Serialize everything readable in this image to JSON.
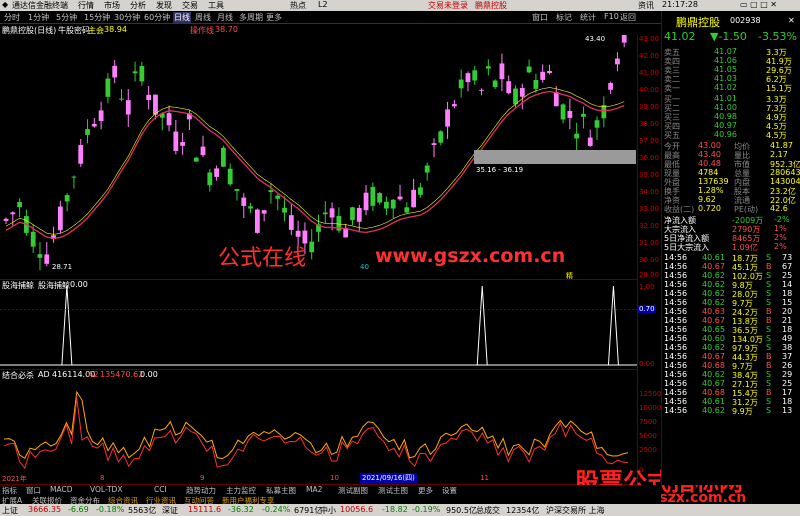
{
  "topbar": {
    "app": "通达信金融终端",
    "menus": [
      "行情",
      "市场",
      "分析",
      "发现",
      "交易",
      "工具",
      "热点",
      "L2"
    ],
    "notice": "交易未登录",
    "stock_tag": "鹏鼎控股",
    "right_items": [
      "资讯",
      "画图",
      "消息",
      "工具"
    ],
    "clock": "21:17:28"
  },
  "periods": [
    "分时",
    "1分钟",
    "5分钟",
    "15分钟",
    "30分钟",
    "60分钟",
    "日线",
    "周线",
    "月线",
    "多周期",
    "更多"
  ],
  "tools": [
    "窗口",
    "标记",
    "统计",
    "F10",
    "返回"
  ],
  "info": {
    "name": "鹏鼎控股(日线)",
    "ind": "牛股密码",
    "lbl1": "主会",
    "v1": "38.94",
    "lbl2": "操作线",
    "v2": "38.70"
  },
  "chart": {
    "high_label": "43.40",
    "low_label": "28.71",
    "range_label": "35.16 - 36.19",
    "date_mark": "2021/09/16(四)",
    "year_left": "2021年",
    "month_left": "8",
    "mid": "9",
    "right": "10",
    "month_right": "11",
    "marker1": "40",
    "marker2": "精",
    "marker3": "精"
  },
  "axis_main": [
    "43.00",
    "42.00",
    "41.00",
    "40.00",
    "39.00",
    "38.00",
    "37.00",
    "36.00",
    "35.00",
    "34.00",
    "33.00",
    "32.00",
    "31.00",
    "30.00",
    "29.00"
  ],
  "p2": {
    "title": "股海捕鲸",
    "sub": "股海捕鲸",
    "val": "0.00",
    "axis": [
      "1.00",
      "0.70",
      "0.00"
    ],
    "ylim": [
      0,
      1
    ],
    "spike_x": [
      0.105,
      0.757,
      0.963
    ]
  },
  "p3": {
    "title": "结合必杀",
    "ad": "AD",
    "adv": "416114.00",
    "a2": "A2",
    "a2v": "135470.62",
    "v3": "0.00",
    "axis": [
      "12500",
      "10000",
      "7500",
      "5000",
      "2500",
      "0"
    ]
  },
  "watermark": {
    "t1": "公式在线",
    "t2": "www.gszx.com.cn",
    "t3": "股票公式指标网",
    "t4": "www.gszx.com.cn"
  },
  "right": {
    "name": "鹏鼎控股",
    "code": "002938",
    "price": "41.02",
    "change": "▼-1.50",
    "pct": "-3.53%",
    "asks": [
      [
        "卖五",
        "41.07",
        "3.3万"
      ],
      [
        "卖四",
        "41.06",
        "41.9万"
      ],
      [
        "卖三",
        "41.05",
        "29.6万"
      ],
      [
        "卖二",
        "41.03",
        "6.2万"
      ],
      [
        "卖一",
        "41.02",
        "15.1万"
      ]
    ],
    "bids": [
      [
        "买一",
        "41.01",
        "3.3万"
      ],
      [
        "买二",
        "41.00",
        "7.3万"
      ],
      [
        "买三",
        "40.98",
        "4.9万"
      ],
      [
        "买四",
        "40.97",
        "4.5万"
      ],
      [
        "买五",
        "40.96",
        "4.5万"
      ]
    ],
    "stats": [
      [
        "今开",
        "43.00",
        "均价",
        "41.87"
      ],
      [
        "最高",
        "43.40",
        "量比",
        "2.17"
      ],
      [
        "最低",
        "40.48",
        "市值",
        "952.3亿"
      ],
      [
        "现量",
        "4784",
        "总量",
        "280643"
      ],
      [
        "外盘",
        "137639",
        "内盘",
        "143004"
      ],
      [
        "换手",
        "1.28%",
        "股本",
        "23.2亿"
      ],
      [
        "净资",
        "9.62",
        "流通",
        "22.0亿"
      ],
      [
        "收益(二)",
        "0.720",
        "PE(动)",
        "42.6"
      ]
    ],
    "flows": [
      [
        "净流入额",
        "-2009万",
        "-2%"
      ],
      [
        "大宗流入",
        "2790万",
        "1%"
      ],
      [
        "5日净流入额",
        "8465万",
        "2%"
      ],
      [
        "5日大宗流入",
        "1.09亿",
        "2%"
      ]
    ],
    "ticks": [
      [
        "14:56",
        "40.61",
        "18.7万",
        "S",
        "73"
      ],
      [
        "14:56",
        "40.67",
        "45.1万",
        "B",
        "67"
      ],
      [
        "14:56",
        "40.62",
        "102.0万",
        "S",
        "25"
      ],
      [
        "14:56",
        "40.62",
        "9.8万",
        "S",
        "14"
      ],
      [
        "14:56",
        "40.62",
        "28.0万",
        "S",
        "18"
      ],
      [
        "14:56",
        "40.62",
        "9.7万",
        "S",
        "15"
      ],
      [
        "14:56",
        "40.63",
        "24.2万",
        "B",
        "20"
      ],
      [
        "14:56",
        "40.67",
        "13.8万",
        "B",
        "21"
      ],
      [
        "14:56",
        "40.65",
        "36.5万",
        "S",
        "18"
      ],
      [
        "14:56",
        "40.60",
        "134.0万",
        "S",
        "49"
      ],
      [
        "14:56",
        "40.62",
        "97.9万",
        "S",
        "38"
      ],
      [
        "14:56",
        "40.67",
        "44.3万",
        "B",
        "37"
      ],
      [
        "14:56",
        "40.68",
        "9.7万",
        "B",
        "26"
      ],
      [
        "14:56",
        "40.62",
        "38.4万",
        "S",
        "29"
      ],
      [
        "14:56",
        "40.67",
        "27.1万",
        "S",
        "25"
      ],
      [
        "14:56",
        "40.68",
        "15.4万",
        "B",
        "17"
      ],
      [
        "14:56",
        "40.61",
        "31.2万",
        "S",
        "18"
      ],
      [
        "14:56",
        "40.62",
        "9.9万",
        "S",
        "13"
      ]
    ]
  },
  "bottomtabs": {
    "row1": [
      "指标",
      "窗口",
      "MACD",
      "VOL-TDX",
      "CCI",
      "趋势动力",
      "主力监控",
      "私募主图",
      "MA2",
      "测试副图",
      "测试主图",
      "更多",
      "设置"
    ],
    "row2": [
      "扩展A",
      "关联报价",
      "资金分布",
      "综合资讯",
      "行业资讯",
      "互动问答",
      "新用户福利专享"
    ]
  },
  "status": {
    "sh": "上证",
    "sh_v": "3666.35",
    "sh_c": "-6.69",
    "sh_p": "-0.18%",
    "sh_a": "5563亿",
    "sz": "深证",
    "sz_v": "15111.6",
    "sz_c": "-36.32",
    "sz_p": "-0.24%",
    "sz_a": "6791亿",
    "zx": "中小",
    "zx_v": "10056.6",
    "zx_c": "-18.82",
    "zx_p": "-0.19%",
    "zx_a": "950.5亿",
    "tot": "总成交",
    "tot_v": "12354亿",
    "tail": "沪深交易所 上海"
  }
}
